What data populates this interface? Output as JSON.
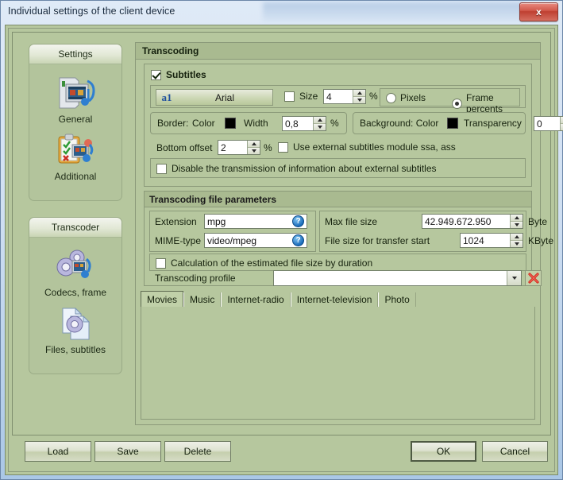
{
  "window": {
    "title": "Individual settings of the client device",
    "close_label": "x"
  },
  "sidebar": {
    "groups": [
      {
        "title": "Settings",
        "items": [
          {
            "label": "General",
            "icon": "device-media-icon"
          },
          {
            "label": "Additional",
            "icon": "checklist-media-icon"
          }
        ]
      },
      {
        "title": "Transcoder",
        "items": [
          {
            "label": "Codecs, frame",
            "icon": "gears-media-icon"
          },
          {
            "label": "Files, subtitles",
            "icon": "files-gear-icon"
          }
        ]
      }
    ]
  },
  "main": {
    "transcoding_title": "Transcoding",
    "subtitles": {
      "group_label": "Subtitles",
      "enabled": true,
      "font_icon": "a1",
      "font_name": "Arial",
      "size_checkbox_checked": false,
      "size_label": "Size",
      "size_value": "4",
      "size_unit": "%",
      "units": [
        {
          "label": "Pixels",
          "selected": false
        },
        {
          "label": "Frame percents",
          "selected": true
        }
      ],
      "border_label": "Border:",
      "border_color_label": "Color",
      "border_color": "#000000",
      "border_width_label": "Width",
      "border_width_value": "0,8",
      "border_width_unit": "%",
      "background_label": "Background: Color",
      "background_color": "#000000",
      "transparency_label": "Transparency",
      "transparency_value": "0",
      "bottom_offset_label": "Bottom offset",
      "bottom_offset_value": "2",
      "bottom_offset_unit": "%",
      "external_module_label": "Use external subtitles module ssa, ass",
      "external_module_checked": false,
      "disable_transmission_label": "Disable the transmission of information about external subtitles",
      "disable_transmission_checked": false
    },
    "file_parameters": {
      "group_label": "Transcoding file parameters",
      "extension_label": "Extension",
      "extension_value": "mpg",
      "mime_label": "MIME-type",
      "mime_value": "video/mpeg",
      "help_icon": "?",
      "max_file_size_label": "Max file size",
      "max_file_size_value": "42.949.672.950",
      "max_file_size_unit": "Byte",
      "transfer_start_label": "File size for transfer start",
      "transfer_start_value": "1024",
      "transfer_start_unit": "KByte",
      "calc_size_label": "Calculation of the estimated file size by duration",
      "calc_size_checked": false,
      "profile_label": "Transcoding profile",
      "profile_value": "",
      "profile_delete_icon": "delete-x-icon"
    },
    "tabs": [
      {
        "label": "Movies",
        "active": true
      },
      {
        "label": "Music",
        "active": false
      },
      {
        "label": "Internet-radio",
        "active": false
      },
      {
        "label": "Internet-television",
        "active": false
      },
      {
        "label": "Photo",
        "active": false
      }
    ]
  },
  "footer": {
    "load": "Load",
    "save": "Save",
    "delete": "Delete",
    "ok": "OK",
    "cancel": "Cancel"
  }
}
